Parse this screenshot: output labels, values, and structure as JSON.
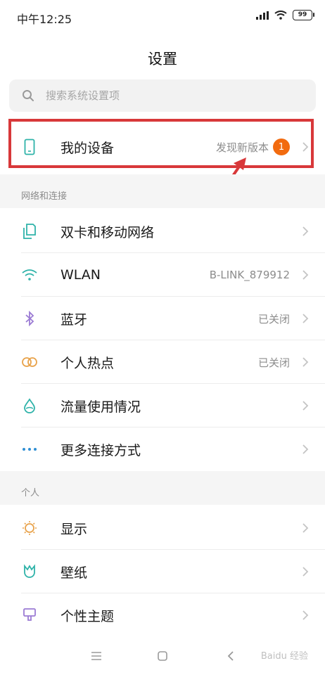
{
  "status_bar": {
    "time": "中午12:25",
    "battery": "99"
  },
  "header": {
    "title": "设置"
  },
  "search": {
    "placeholder": "搜索系统设置项"
  },
  "my_device": {
    "label": "我的设备",
    "value": "发现新版本",
    "badge": "1"
  },
  "sections": {
    "network": {
      "title": "网络和连接",
      "items": [
        {
          "label": "双卡和移动网络",
          "value": ""
        },
        {
          "label": "WLAN",
          "value": "B-LINK_879912"
        },
        {
          "label": "蓝牙",
          "value": "已关闭"
        },
        {
          "label": "个人热点",
          "value": "已关闭"
        },
        {
          "label": "流量使用情况",
          "value": ""
        },
        {
          "label": "更多连接方式",
          "value": ""
        }
      ]
    },
    "personal": {
      "title": "个人",
      "items": [
        {
          "label": "显示"
        },
        {
          "label": "壁纸"
        },
        {
          "label": "个性主题"
        }
      ]
    }
  },
  "watermark": "Baidu 经验",
  "colors": {
    "accent_badge": "#f26b0f",
    "highlight": "#d8383a",
    "icon_teal": "#2fb3a9"
  }
}
